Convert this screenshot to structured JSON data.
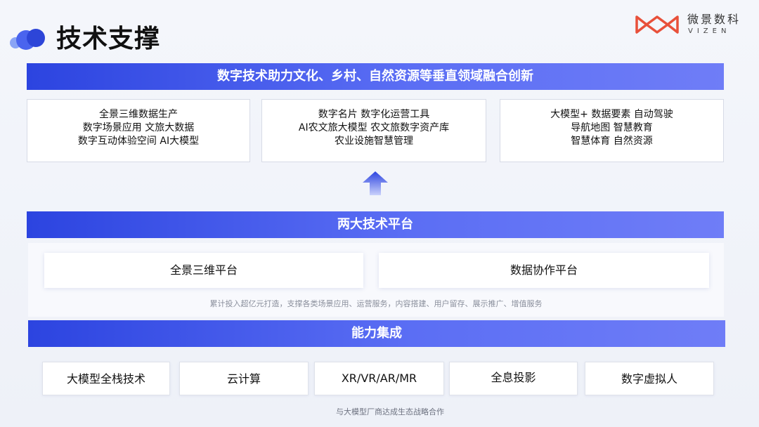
{
  "header": {
    "title": "技术支撑",
    "brand_cn": "微景数科",
    "brand_en": "VIZEN"
  },
  "colors": {
    "accent": "#2c44e0",
    "accent_light": "#6f7df7",
    "brand_red": "#e8503a"
  },
  "icons": {
    "logo": "three-dots-icon",
    "brand": "vizen-logo-icon",
    "arrow": "up-arrow-icon"
  },
  "innovation": {
    "banner": "数字技术助力文化、乡村、自然资源等垂直领域融合创新",
    "boxes": [
      {
        "lines": [
          "全景三维数据生产",
          "数字场景应用 文旅大数据",
          "数字互动体验空间 AI大模型"
        ]
      },
      {
        "lines": [
          "数字名片 数字化运营工具",
          "AI农文旅大模型 农文旅数字资产库",
          "农业设施智慧管理"
        ]
      },
      {
        "lines": [
          "大模型+  数据要素 自动驾驶",
          "导航地图 智慧教育",
          "智慧体育 自然资源"
        ]
      }
    ]
  },
  "platforms": {
    "banner": "两大技术平台",
    "items": [
      "全景三维平台",
      "数据协作平台"
    ],
    "note": "累计投入超亿元打造，支撑各类场景应用、运营服务，内容搭建、用户留存、展示推广、增值服务"
  },
  "abilities": {
    "banner": "能力集成",
    "items": [
      "大模型全栈技术",
      "云计算",
      "XR/VR/AR/MR",
      "全息投影",
      "数字虚拟人"
    ],
    "note": "与大模型厂商达成生态战略合作"
  }
}
